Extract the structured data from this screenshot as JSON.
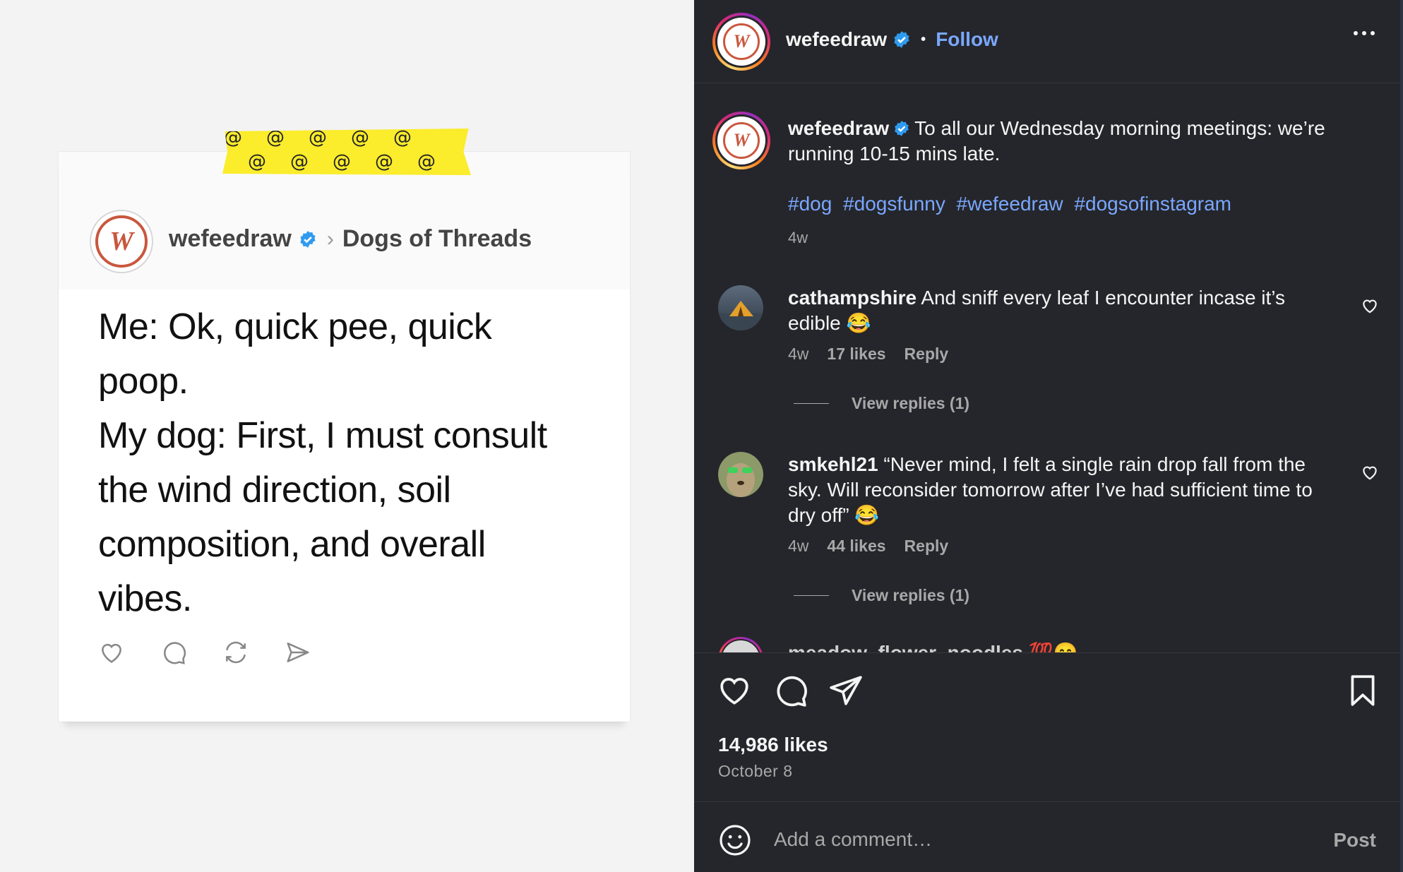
{
  "post_image": {
    "card_user": "wefeedraw",
    "community": "Dogs of Threads",
    "avatar_letter": "W",
    "tape_glyphs": "@@@@@",
    "text_lines": [
      "Me: Ok, quick pee, quick",
      "poop.",
      "My dog: First, I must consult",
      "the wind direction, soil",
      "composition, and overall",
      "vibes."
    ],
    "tape_color": "#fbec2c"
  },
  "header": {
    "username": "wefeedraw",
    "separator": "•",
    "follow_label": "Follow"
  },
  "caption": {
    "username": "wefeedraw",
    "text": "To all our Wednesday morning meetings: we’re running 10-15 mins late.",
    "hashtags": [
      "#dog",
      "#dogsfunny",
      "#wefeedraw",
      "#dogsofinstagram"
    ],
    "time": "4w"
  },
  "comments": [
    {
      "username": "cathampshire",
      "text": "And sniff every leaf I encounter incase it’s edible 😂",
      "time": "4w",
      "likes": "17 likes",
      "reply_label": "Reply",
      "view_replies": "View replies (1)"
    },
    {
      "username": "smkehl21",
      "text": "“Never mind, I felt a single rain drop fall from the sky. Will reconsider tomorrow after I’ve had sufficient time to dry off” 😂",
      "time": "4w",
      "likes": "44 likes",
      "reply_label": "Reply",
      "view_replies": "View replies (1)"
    }
  ],
  "partial_comment": "meadow_flower_noodles 💯😊",
  "footer": {
    "likes": "14,986 likes",
    "date": "October 8",
    "comment_placeholder": "Add a comment…",
    "post_label": "Post"
  },
  "colors": {
    "accent_link": "#7aa7ff",
    "verified": "#2f9bf0",
    "sidebar_bg": "#25262b"
  },
  "icons": [
    "heart-icon",
    "comment-icon",
    "repost-icon",
    "share-icon",
    "bookmark-icon",
    "emoji-icon",
    "more-icon",
    "verified-badge-icon"
  ]
}
